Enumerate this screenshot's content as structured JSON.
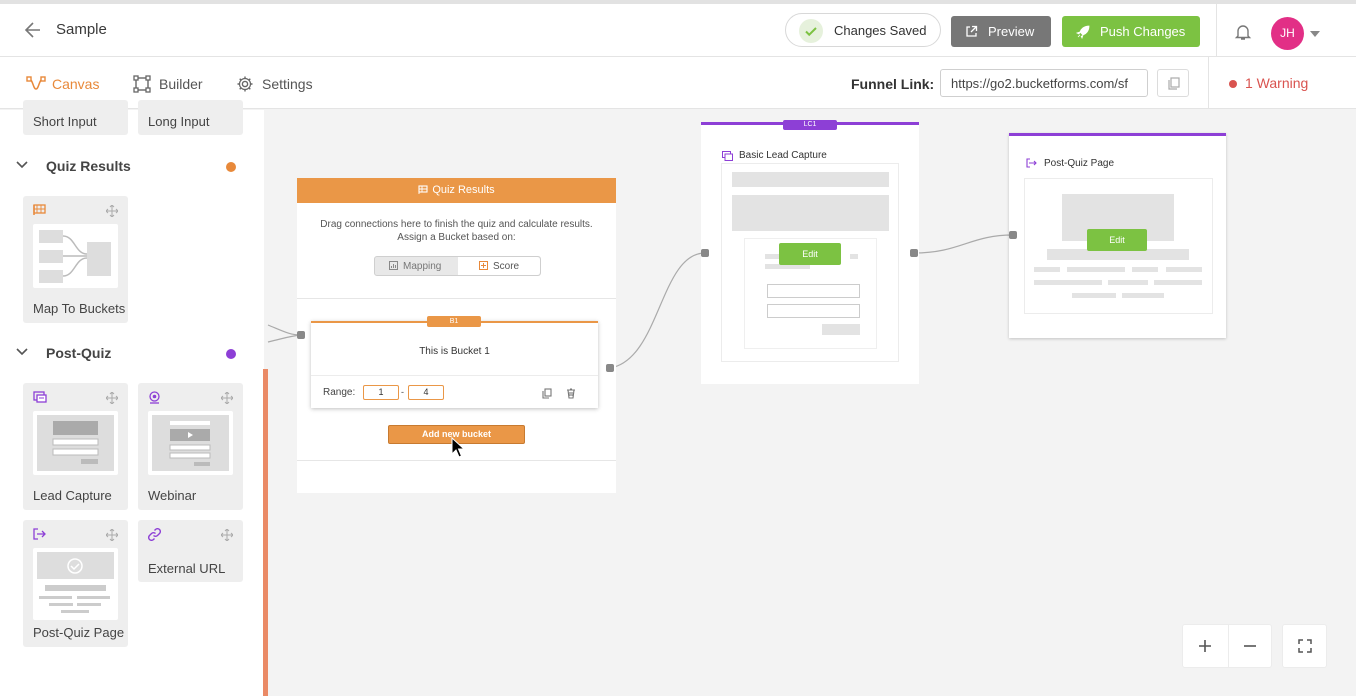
{
  "header": {
    "title": "Sample",
    "saved_label": "Changes Saved",
    "preview_label": "Preview",
    "push_label": "Push Changes",
    "avatar_initials": "JH"
  },
  "nav": {
    "tabs": [
      {
        "label": "Canvas",
        "active": true
      },
      {
        "label": "Builder",
        "active": false
      },
      {
        "label": "Settings",
        "active": false
      }
    ],
    "funnel_link_label": "Funnel Link:",
    "funnel_link_value": "https://go2.bucketforms.com/sf",
    "warning_label": "1 Warning"
  },
  "sidebar": {
    "top_items": [
      "Short Input",
      "Long Input"
    ],
    "sections": [
      {
        "title": "Quiz Results",
        "dot_color": "#e8893a",
        "items": [
          "Map To Buckets"
        ]
      },
      {
        "title": "Post-Quiz",
        "dot_color": "#8d3fd6",
        "items": [
          "Lead Capture",
          "Webinar",
          "Post-Quiz Page",
          "External URL"
        ]
      }
    ]
  },
  "canvas": {
    "quiz_results": {
      "title": "Quiz Results",
      "description_line1": "Drag connections here to finish the quiz and calculate results.",
      "description_line2": "Assign a Bucket based on:",
      "toggle_mapping": "Mapping",
      "toggle_score": "Score",
      "bucket": {
        "tag": "B1",
        "title": "This is Bucket 1",
        "range_label": "Range:",
        "range_from": "1",
        "range_sep": "-",
        "range_to": "4"
      },
      "add_bucket_label": "Add new bucket"
    },
    "lead_capture": {
      "tag": "LC1",
      "title": "Basic Lead Capture",
      "edit_label": "Edit"
    },
    "post_quiz": {
      "title": "Post-Quiz Page",
      "edit_label": "Edit"
    }
  },
  "colors": {
    "accent_orange": "#ea9747",
    "accent_green": "#7cc242",
    "accent_purple": "#8d3fd6",
    "warning_red": "#d9534f",
    "avatar_pink": "#e22f86"
  },
  "icons": [
    "back-arrow-icon",
    "check-icon",
    "external-link-icon",
    "rocket-icon",
    "bell-icon",
    "chevron-down-icon",
    "canvas-icon",
    "builder-icon",
    "gear-icon",
    "copy-icon",
    "flag-icon",
    "move-icon",
    "form-icon",
    "webinar-icon",
    "exit-icon",
    "link-icon",
    "trash-icon",
    "plus-icon",
    "minus-icon",
    "fullscreen-icon"
  ]
}
